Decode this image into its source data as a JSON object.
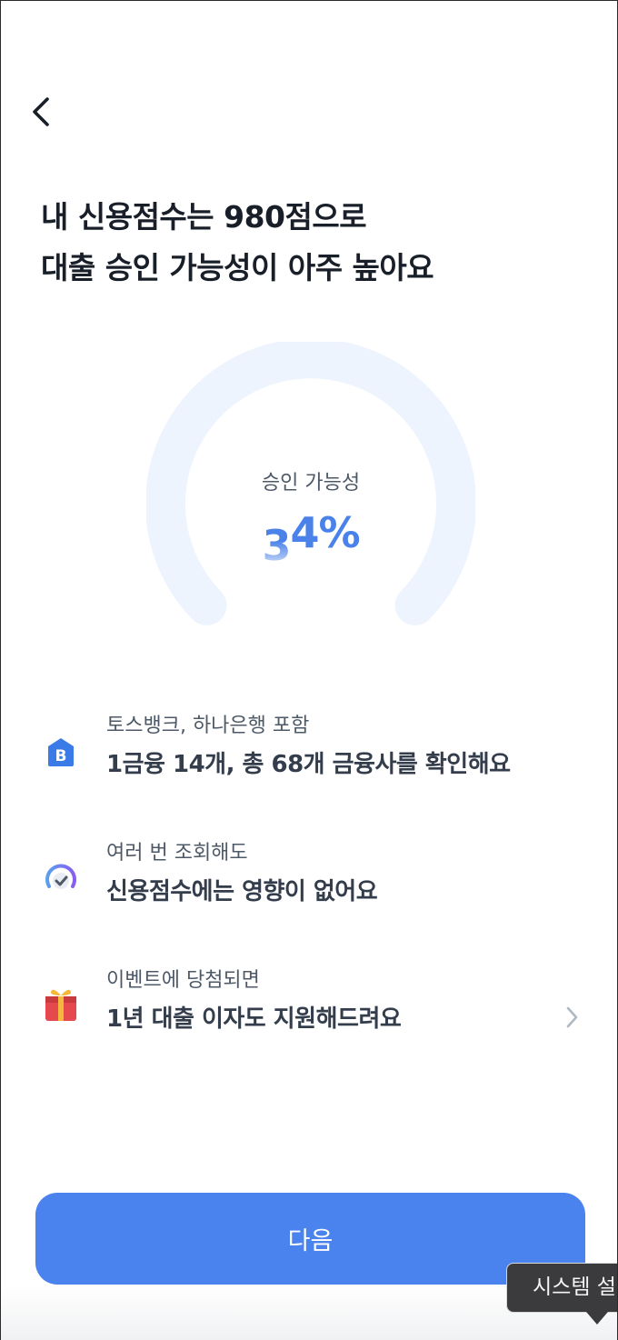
{
  "header": {
    "back_icon": "chevron-left-icon",
    "title_line1": "내 신용점수는 980점으로",
    "title_line2": "대출 승인 가능성이 아주 높아요"
  },
  "gauge": {
    "label": "승인 가능성",
    "value_digit_faded": "3",
    "value_rest": "4%",
    "track_color": "#eef4fd"
  },
  "info_items": [
    {
      "icon": "bank-building-icon",
      "sub": "토스뱅크, 하나은행 포함",
      "main": "1금융 14개, 총 68개 금융사를 확인해요"
    },
    {
      "icon": "gauge-check-icon",
      "sub": "여러 번 조회해도",
      "main": "신용점수에는 영향이 없어요"
    },
    {
      "icon": "gift-icon",
      "sub": "이벤트에 당첨되면",
      "main": "1년 대출 이자도 지원해드려요",
      "has_chevron": true
    }
  ],
  "footer": {
    "next_label": "다음"
  },
  "tooltip": {
    "text": "시스템 설"
  },
  "colors": {
    "accent": "#4a82ee",
    "text_primary": "#191f28",
    "text_secondary": "#4e5968"
  }
}
